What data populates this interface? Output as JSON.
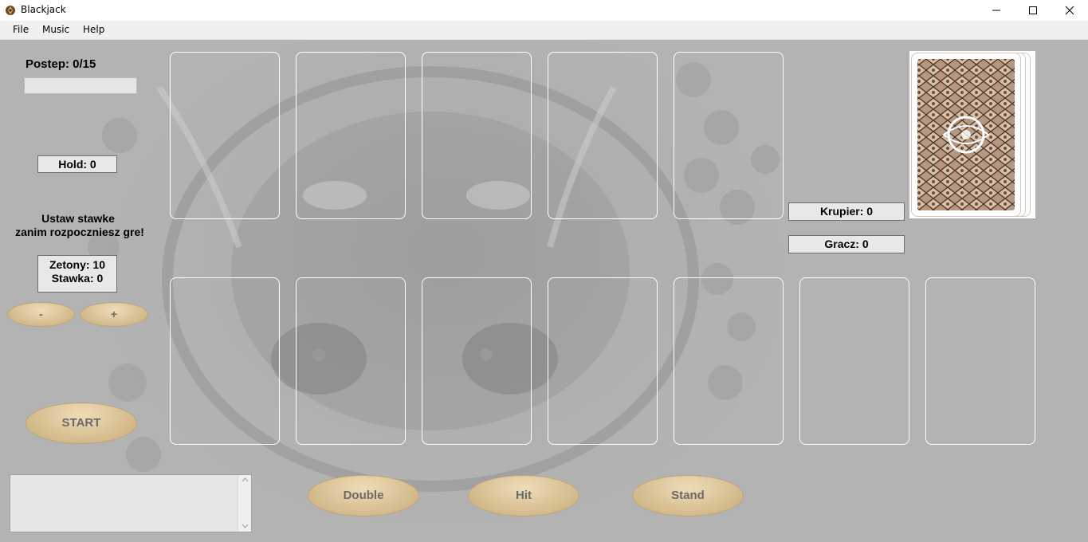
{
  "window": {
    "title": "Blackjack",
    "icon": "spade-emblem-icon"
  },
  "menu": {
    "items": [
      "File",
      "Music",
      "Help"
    ]
  },
  "stats": {
    "progress_label": "Postep: 0/15",
    "progress_value": 0,
    "hold_label": "Hold: 0",
    "instruction_line1": "Ustaw stawke",
    "instruction_line2": "zanim rozpoczniesz gre!",
    "chips_label": "Zetony: 10",
    "bet_label": "Stawka: 0",
    "dealer_label": "Krupier: 0",
    "player_label": "Gracz: 0"
  },
  "controls": {
    "minus": "-",
    "plus": "+",
    "start": "START",
    "double": "Double",
    "hit": "Hit",
    "stand": "Stand"
  },
  "log": {
    "text": ""
  },
  "colors": {
    "table_bg": "#b3b3b3",
    "button_gold": "#d9c194",
    "slot_border": "#ffffff"
  }
}
